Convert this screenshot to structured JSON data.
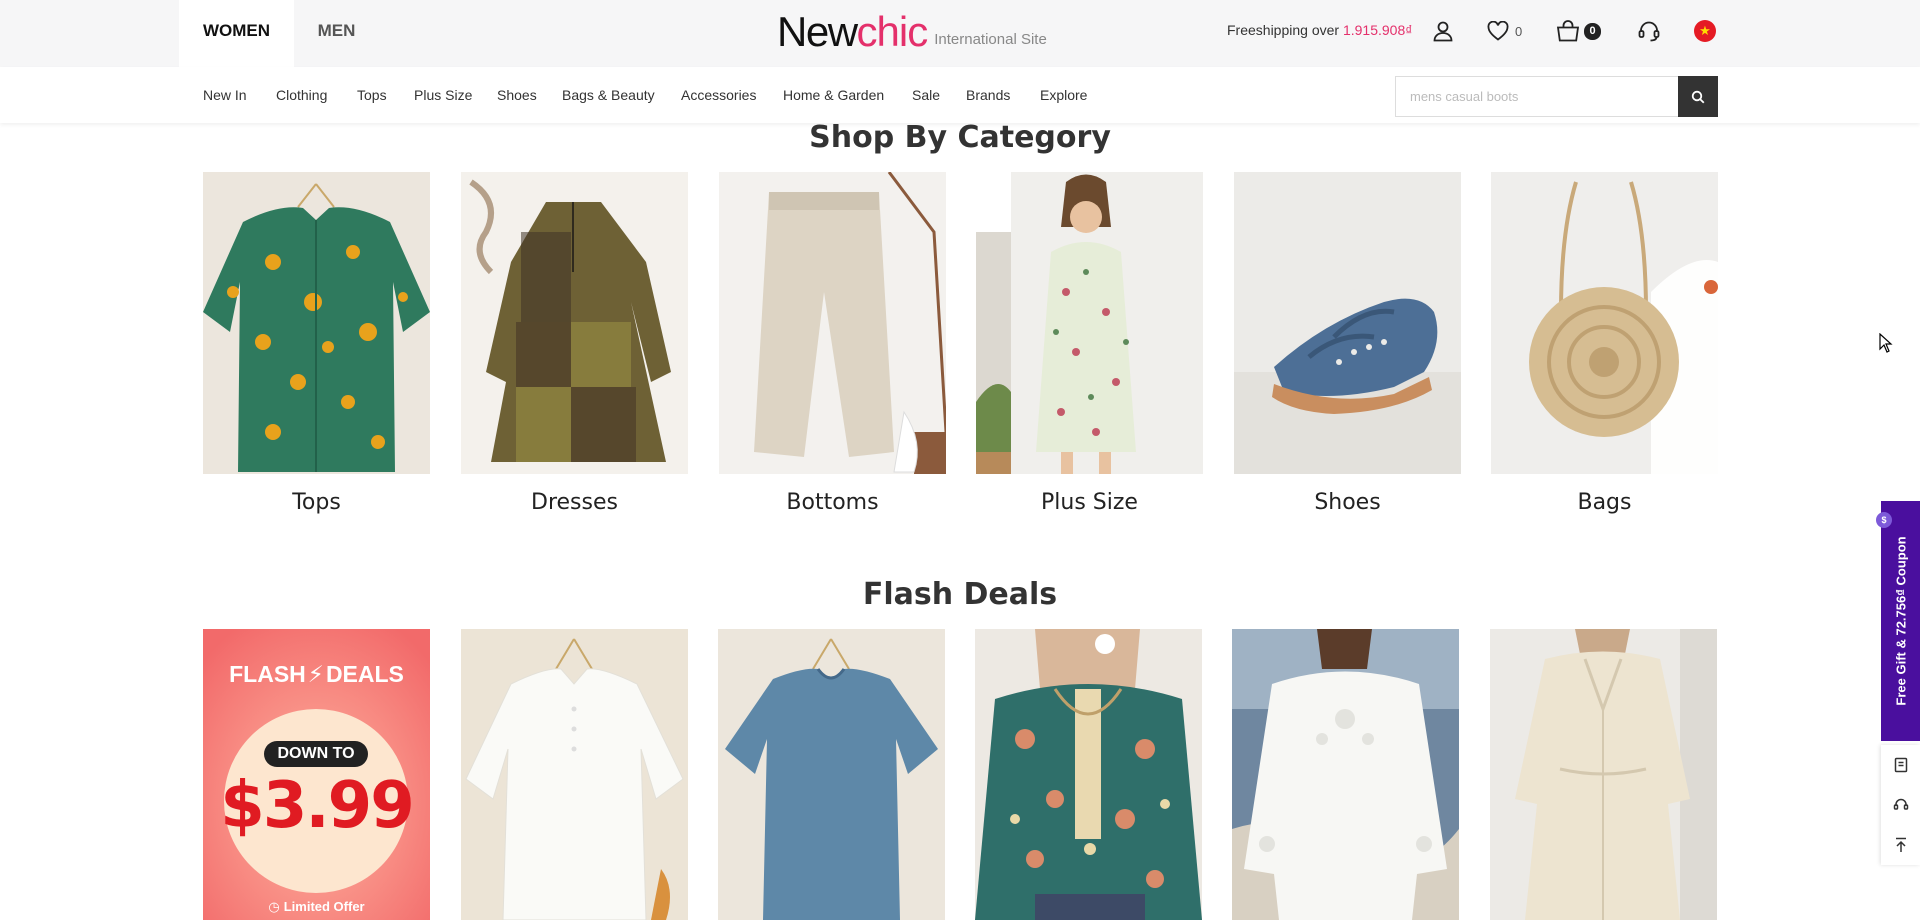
{
  "header": {
    "gender_tabs": [
      {
        "label": "WOMEN",
        "active": true
      },
      {
        "label": "MEN",
        "active": false
      }
    ],
    "logo": {
      "part1": "New",
      "part2": "chic",
      "subtitle": "International Site"
    },
    "freeshipping": {
      "text": "Freeshipping over ",
      "amount": "1.915.908₫"
    },
    "wishlist_count": "0",
    "cart_count": "0",
    "icons": [
      "account-icon",
      "heart-icon",
      "cart-icon",
      "support-icon",
      "vietnam-flag-icon"
    ]
  },
  "nav": {
    "items": [
      "New In",
      "Clothing",
      "Tops",
      "Plus Size",
      "Shoes",
      "Bags & Beauty",
      "Accessories",
      "Home & Garden",
      "Sale",
      "Brands",
      "Explore"
    ],
    "search_placeholder": "mens casual boots"
  },
  "shop_by_category": {
    "title": "Shop By Category",
    "categories": [
      {
        "label": "Tops"
      },
      {
        "label": "Dresses"
      },
      {
        "label": "Bottoms"
      },
      {
        "label": "Plus Size"
      },
      {
        "label": "Shoes"
      },
      {
        "label": "Bags"
      }
    ]
  },
  "flash_deals": {
    "title": "Flash Deals",
    "banner": {
      "headline": "FLASH",
      "headline2": "DEALS",
      "down_to": "DOWN TO",
      "price": "$3.99",
      "tag": "Limited Offer"
    }
  },
  "side_rail": {
    "coupon_text": "Free Gift & 72.756₫ Coupon",
    "coin_label": "$"
  },
  "colors": {
    "accent": "#e4306b",
    "coupon_bg": "#4a0f9e",
    "topbar_bg": "#f6f6f7"
  }
}
